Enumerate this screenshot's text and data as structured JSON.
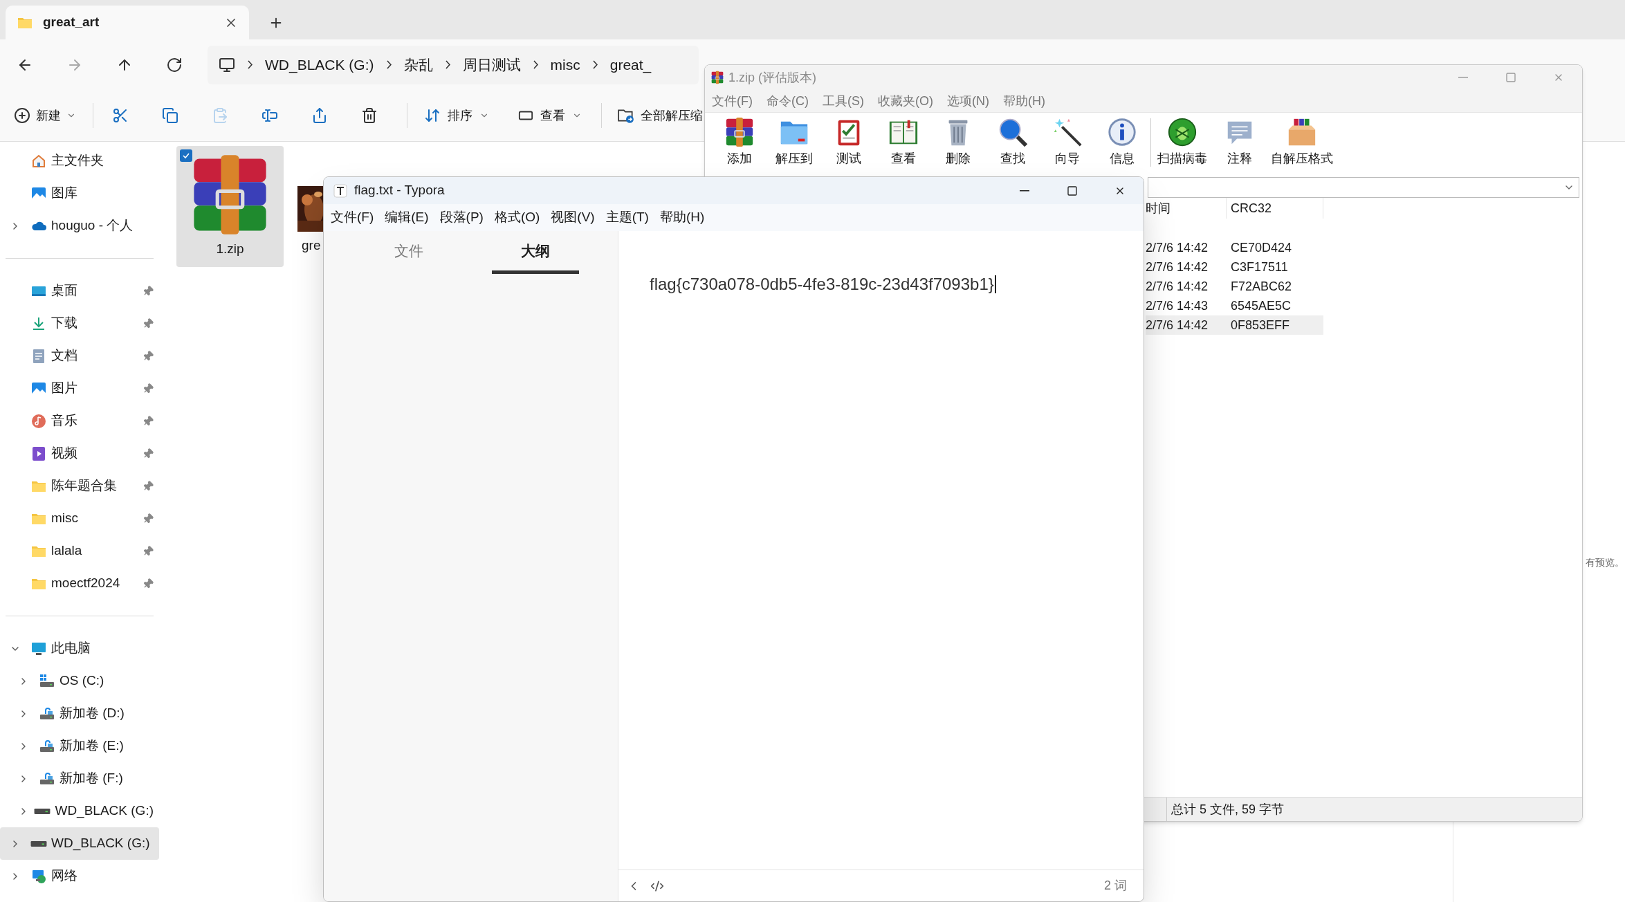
{
  "explorer": {
    "tab": {
      "title": "great_art"
    },
    "breadcrumbs": [
      "WD_BLACK (G:)",
      "杂乱",
      "周日测试",
      "misc",
      "great_"
    ],
    "toolbar": {
      "new": "新建",
      "icon_buttons": [
        {
          "disabled": false
        },
        {
          "disabled": false
        },
        {
          "disabled": true
        },
        {
          "disabled": false
        },
        {
          "disabled": false
        },
        {
          "disabled": false
        }
      ],
      "sort": "排序",
      "view": "查看",
      "extract_all": "全部解压缩"
    },
    "sidebar": {
      "groups": [
        [
          {
            "label": "主文件夹",
            "kind": "home",
            "selected": false
          },
          {
            "label": "图库",
            "kind": "gallery",
            "selected": false
          },
          {
            "label": "houguo - 个人",
            "kind": "cloud",
            "expanded": false,
            "selected": false
          }
        ],
        [
          {
            "label": "桌面",
            "kind": "desktop",
            "pinned": true,
            "selected": false
          },
          {
            "label": "下载",
            "kind": "download",
            "pinned": true,
            "selected": false
          },
          {
            "label": "文档",
            "kind": "documents",
            "pinned": true,
            "selected": false
          },
          {
            "label": "图片",
            "kind": "pictures",
            "pinned": true,
            "selected": false
          },
          {
            "label": "音乐",
            "kind": "music",
            "pinned": true,
            "selected": false
          },
          {
            "label": "视频",
            "kind": "videos",
            "pinned": true,
            "selected": false
          },
          {
            "label": "陈年题合集",
            "kind": "folder",
            "pinned": true,
            "selected": false
          },
          {
            "label": "misc",
            "kind": "folder",
            "pinned": true,
            "selected": false
          },
          {
            "label": "lalala",
            "kind": "folder",
            "pinned": true,
            "selected": false
          },
          {
            "label": "moectf2024",
            "kind": "folder",
            "pinned": true,
            "selected": false
          }
        ],
        [
          {
            "label": "此电脑",
            "kind": "pc",
            "expanded": true,
            "selected": false,
            "children": [
              {
                "label": "OS (C:)",
                "kind": "system_drive",
                "expanded": false,
                "selected": false
              },
              {
                "label": "新加卷 (D:)",
                "kind": "locked_drive",
                "expanded": false,
                "selected": false
              },
              {
                "label": "新加卷 (E:)",
                "kind": "locked_drive",
                "expanded": false,
                "selected": false
              },
              {
                "label": "新加卷 (F:)",
                "kind": "locked_drive",
                "expanded": false,
                "selected": false
              },
              {
                "label": "WD_BLACK (G:)",
                "kind": "drive",
                "expanded": false,
                "selected": false
              }
            ]
          },
          {
            "label": "WD_BLACK (G:)",
            "kind": "drive",
            "expanded": false,
            "selected": true
          },
          {
            "label": "网络",
            "kind": "network",
            "expanded": false,
            "selected": false
          }
        ]
      ]
    },
    "files": [
      {
        "name": "1.zip",
        "kind": "archive",
        "selected": true
      },
      {
        "name": "gre",
        "kind": "picture",
        "selected": false
      }
    ],
    "preview_note": "有预览。"
  },
  "winrar": {
    "title": "1.zip (评估版本)",
    "menu": [
      "文件(F)",
      "命令(C)",
      "工具(S)",
      "收藏夹(O)",
      "选项(N)",
      "帮助(H)"
    ],
    "toolbar": [
      [
        {
          "label": "添加",
          "kind": "add"
        },
        {
          "label": "解压到",
          "kind": "extract"
        },
        {
          "label": "测试",
          "kind": "test"
        },
        {
          "label": "查看",
          "kind": "view"
        },
        {
          "label": "删除",
          "kind": "delete"
        },
        {
          "label": "查找",
          "kind": "find"
        },
        {
          "label": "向导",
          "kind": "wizard"
        },
        {
          "label": "信息",
          "kind": "info"
        }
      ],
      [
        {
          "label": "扫描病毒",
          "kind": "scan"
        },
        {
          "label": "注释",
          "kind": "comment"
        },
        {
          "label": "自解压格式",
          "kind": "sfx"
        }
      ]
    ],
    "columns": [
      "时间",
      "CRC32"
    ],
    "rows": [
      {
        "modified": "2/7/6 14:42",
        "crc32": "CE70D424",
        "selected": false
      },
      {
        "modified": "2/7/6 14:42",
        "crc32": "C3F17511",
        "selected": false
      },
      {
        "modified": "2/7/6 14:42",
        "crc32": "F72ABC62",
        "selected": false
      },
      {
        "modified": "2/7/6 14:43",
        "crc32": "6545AE5C",
        "selected": false
      },
      {
        "modified": "2/7/6 14:42",
        "crc32": "0F853EFF",
        "selected": true
      }
    ],
    "status": "总计 5 文件, 59 字节"
  },
  "typora": {
    "title": "flag.txt - Typora",
    "menu": [
      "文件(F)",
      "编辑(E)",
      "段落(P)",
      "格式(O)",
      "视图(V)",
      "主题(T)",
      "帮助(H)"
    ],
    "tabs": [
      {
        "label": "文件",
        "selected": false
      },
      {
        "label": "大纲",
        "selected": true
      }
    ],
    "content": "flag{c730a078-0db5-4fe3-819c-23d43f7093b1}",
    "word_count": "2 词"
  }
}
